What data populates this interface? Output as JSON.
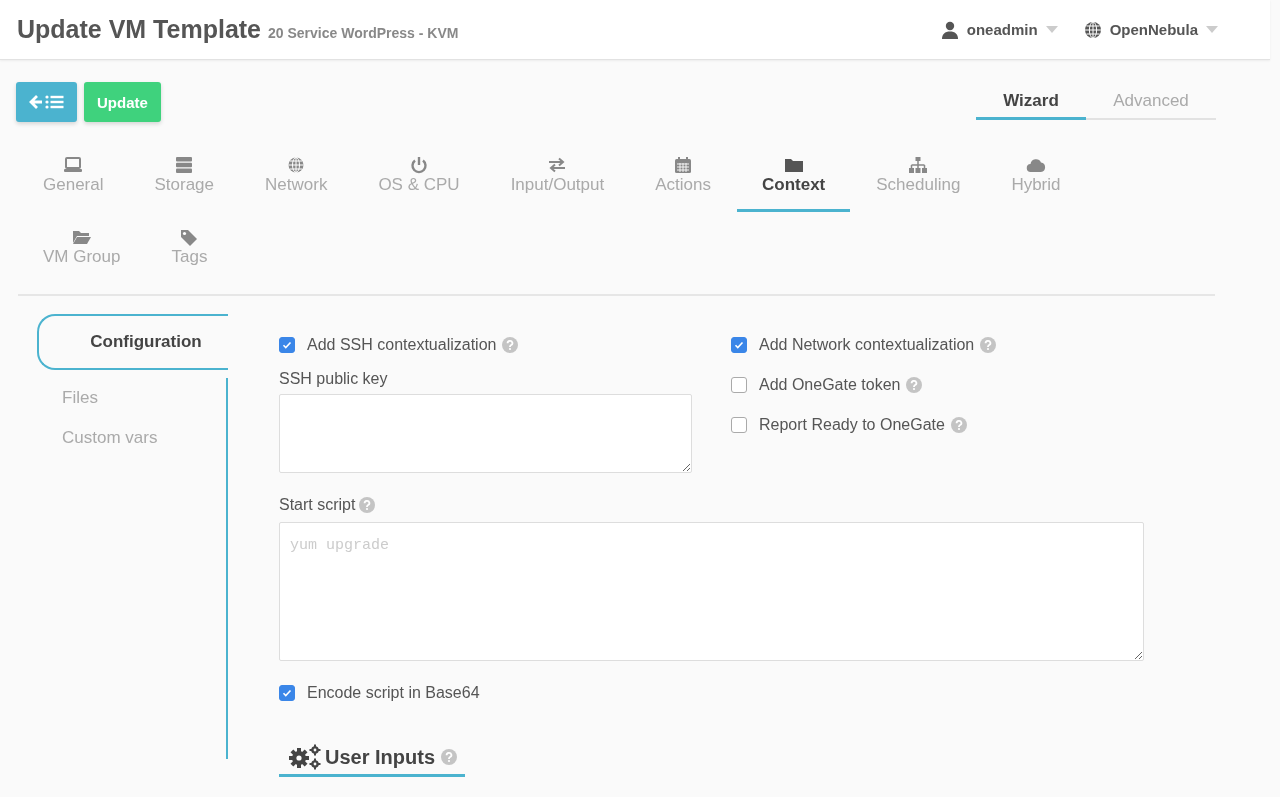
{
  "header": {
    "title": "Update VM Template",
    "subtitle": "20 Service WordPress - KVM",
    "user": "oneadmin",
    "zone": "OpenNebula"
  },
  "toolbar": {
    "update_label": "Update"
  },
  "view_tabs": [
    {
      "label": "Wizard",
      "selected": true
    },
    {
      "label": "Advanced",
      "selected": false
    }
  ],
  "tabs": [
    {
      "label": "General",
      "selected": false
    },
    {
      "label": "Storage",
      "selected": false
    },
    {
      "label": "Network",
      "selected": false
    },
    {
      "label": "OS & CPU",
      "selected": false
    },
    {
      "label": "Input/Output",
      "selected": false
    },
    {
      "label": "Actions",
      "selected": false
    },
    {
      "label": "Context",
      "selected": true
    },
    {
      "label": "Scheduling",
      "selected": false
    },
    {
      "label": "Hybrid",
      "selected": false
    },
    {
      "label": "VM Group",
      "selected": false
    },
    {
      "label": "Tags",
      "selected": false
    }
  ],
  "sidenav": [
    {
      "label": "Configuration",
      "selected": true
    },
    {
      "label": "Files",
      "selected": false
    },
    {
      "label": "Custom vars",
      "selected": false
    }
  ],
  "configuration": {
    "ssh_context": {
      "label": "Add SSH contextualization",
      "checked": true,
      "help": true
    },
    "ssh_key_label": "SSH public key",
    "options": [
      {
        "label": "Add Network contextualization",
        "checked": true,
        "help": true
      },
      {
        "label": "Add OneGate token",
        "checked": false,
        "help": true
      },
      {
        "label": "Report Ready to OneGate",
        "checked": false,
        "help": true
      }
    ],
    "start_script": {
      "label": "Start script",
      "help": true,
      "placeholder": "yum upgrade"
    },
    "encode": {
      "label": "Encode script in Base64",
      "checked": true,
      "help": false
    },
    "user_inputs": {
      "title": "User Inputs",
      "help": true
    }
  }
}
